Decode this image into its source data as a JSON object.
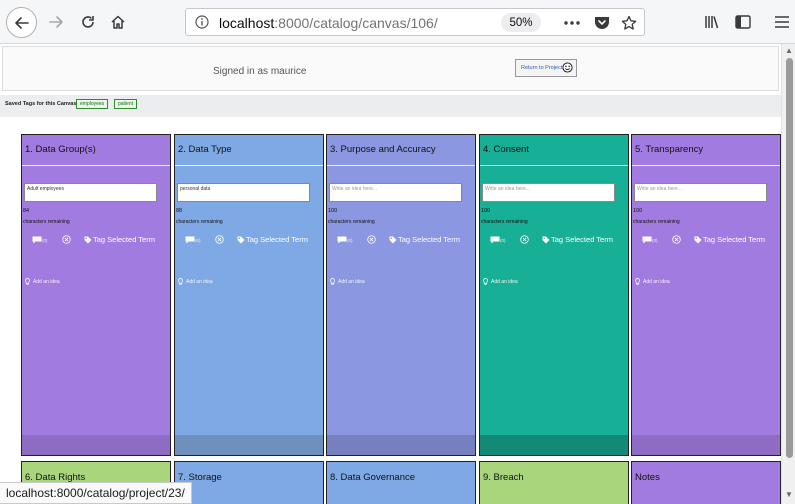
{
  "browser": {
    "url_host": "localhost",
    "url_rest": ":8000/catalog/canvas/106/",
    "zoom": "50%",
    "status_link": "localhost:8000/catalog/project/23/"
  },
  "header": {
    "signed_in": "Signed in as maurice",
    "return_button": "Return to Project"
  },
  "tags": {
    "label": "Saved Tags for this Canvas:",
    "items": [
      "employees",
      "patient"
    ]
  },
  "cards": [
    {
      "title": "1. Data Group(s)",
      "input_value": "Adult employees",
      "placeholder": "",
      "count": "84",
      "color": "#a27be0",
      "footer": "#8e6cc3"
    },
    {
      "title": "2. Data Type",
      "input_value": "personal data",
      "placeholder": "",
      "count": "88",
      "color": "#7fa9e5",
      "footer": "#6f8fbd"
    },
    {
      "title": "3. Purpose and Accuracy",
      "input_value": "",
      "placeholder": "Write an idea here...",
      "count": "100",
      "color": "#8b97e0",
      "footer": "#7680c0"
    },
    {
      "title": "4. Consent",
      "input_value": "",
      "placeholder": "Write an idea here...",
      "count": "100",
      "color": "#17b096",
      "footer": "#138a76"
    },
    {
      "title": "5. Transparency",
      "input_value": "",
      "placeholder": "Write an idea here...",
      "count": "100",
      "color": "#a27be0",
      "footer": "#8e6cc3"
    }
  ],
  "card_common": {
    "chars_remaining": "characters remaining",
    "comment_count": "(0)",
    "tag_selected": "Tag Selected Term",
    "add_idea": "Add an idea"
  },
  "cards_row2": [
    {
      "title": "6. Data Rights",
      "color": "#a9d67c"
    },
    {
      "title": "7. Storage",
      "color": "#7fa9e5"
    },
    {
      "title": "8. Data Governance",
      "color": "#7fa9e5"
    },
    {
      "title": "9. Breach",
      "color": "#a9d67c"
    },
    {
      "title": "Notes",
      "color": "#a27be0"
    }
  ]
}
